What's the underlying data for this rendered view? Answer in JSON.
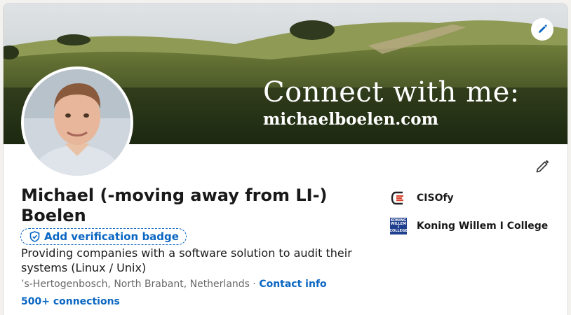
{
  "profile": {
    "name": "Michael (-moving away from LI-) Boelen",
    "verify_label": "Add verification badge",
    "headline": "Providing companies with a software solution to audit their systems (Linux / Unix)",
    "location": "’s-Hertogenbosch, North Brabant, Netherlands",
    "separator": " · ",
    "contact_label": "Contact info",
    "connections": "500+ connections"
  },
  "banner": {
    "line1": "Connect with me:",
    "line2": "michaelboelen.com"
  },
  "experience": [
    {
      "name": "CISOfy",
      "logo": "cisofy-logo"
    },
    {
      "name": "Koning Willem I College",
      "logo": "koning-willem-college-logo",
      "logo_text": [
        "KONING",
        "WILLEM I",
        "COLLEGE"
      ]
    }
  ],
  "icons": {
    "banner_edit": "pencil-icon",
    "intro_edit": "pencil-icon",
    "verify": "shield-check-icon"
  },
  "colors": {
    "link": "#0a66c2",
    "page_bg": "#f3f2ef",
    "cisofy_accent": "#d9412b"
  }
}
